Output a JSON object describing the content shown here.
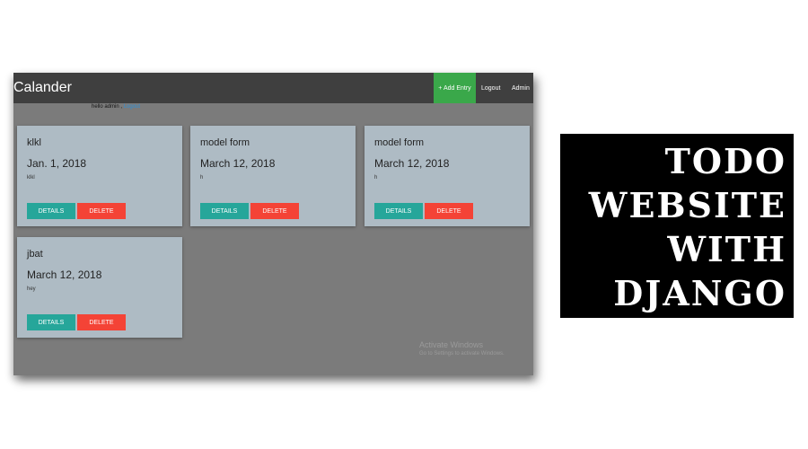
{
  "app": {
    "title": "Calander"
  },
  "nav": {
    "add_entry": "+ Add Entry",
    "logout": "Logout",
    "admin": "Admin"
  },
  "greeting": {
    "text": "hello admin ,",
    "logout_link": "Logout"
  },
  "cards": [
    {
      "title": "klkl",
      "date": "Jan. 1, 2018",
      "description": "klkl",
      "details_label": "DETAILS",
      "delete_label": "DELETE"
    },
    {
      "title": "model form",
      "date": "March 12, 2018",
      "description": "h",
      "details_label": "DETAILS",
      "delete_label": "DELETE"
    },
    {
      "title": "model form",
      "date": "March 12, 2018",
      "description": "h",
      "details_label": "DETAILS",
      "delete_label": "DELETE"
    },
    {
      "title": "jbat",
      "date": "March 12, 2018",
      "description": "hey",
      "details_label": "DETAILS",
      "delete_label": "DELETE"
    }
  ],
  "watermark": {
    "line1": "Activate Windows",
    "line2": "Go to Settings to activate Windows."
  },
  "promo": {
    "lines": [
      "TODO",
      "WEBSITE",
      "WITH",
      "DJANGO"
    ]
  },
  "colors": {
    "navbar": "#3f3f3f",
    "add_button": "#3aa84a",
    "details_button": "#26a69a",
    "delete_button": "#f44336",
    "card": "#aebbc4",
    "background": "#7b7b7b",
    "link": "#2f8fd6"
  }
}
